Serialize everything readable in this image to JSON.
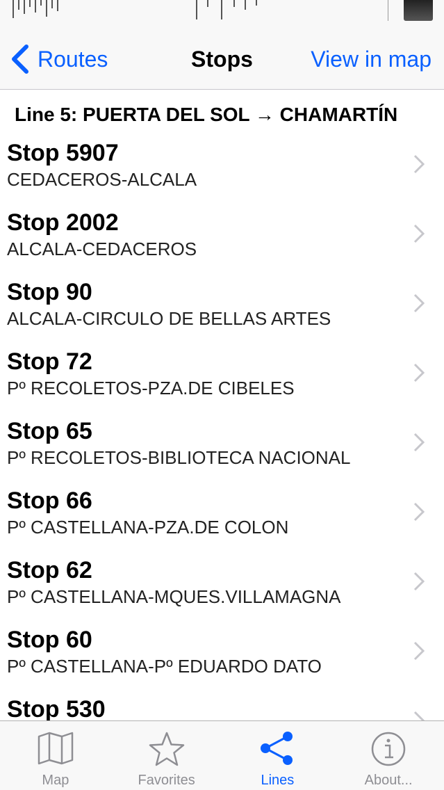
{
  "nav": {
    "back_label": "Routes",
    "title": "Stops",
    "action_label": "View in map"
  },
  "section": {
    "header": "Line 5: PUERTA DEL SOL → CHAMARTÍN"
  },
  "stops": [
    {
      "title": "Stop 5907",
      "name": "CEDACEROS-ALCALA"
    },
    {
      "title": "Stop 2002",
      "name": "ALCALA-CEDACEROS"
    },
    {
      "title": "Stop 90",
      "name": "ALCALA-CIRCULO DE BELLAS ARTES"
    },
    {
      "title": "Stop 72",
      "name": "Pº RECOLETOS-PZA.DE CIBELES"
    },
    {
      "title": "Stop 65",
      "name": "Pº RECOLETOS-BIBLIOTECA NACIONAL"
    },
    {
      "title": "Stop 66",
      "name": "Pº CASTELLANA-PZA.DE COLON"
    },
    {
      "title": "Stop 62",
      "name": "Pº CASTELLANA-MQUES.VILLAMAGNA"
    },
    {
      "title": "Stop 60",
      "name": "Pº CASTELLANA-Pº EDUARDO DATO"
    },
    {
      "title": "Stop 530",
      "name": ""
    }
  ],
  "tabs": [
    {
      "label": "Map",
      "icon": "map-icon"
    },
    {
      "label": "Favorites",
      "icon": "star-icon"
    },
    {
      "label": "Lines",
      "icon": "share-icon",
      "active": true
    },
    {
      "label": "About...",
      "icon": "info-icon"
    }
  ],
  "colors": {
    "accent": "#0a60ff",
    "inactive": "#8e8e93",
    "bar_background": "#f8f8f8"
  }
}
